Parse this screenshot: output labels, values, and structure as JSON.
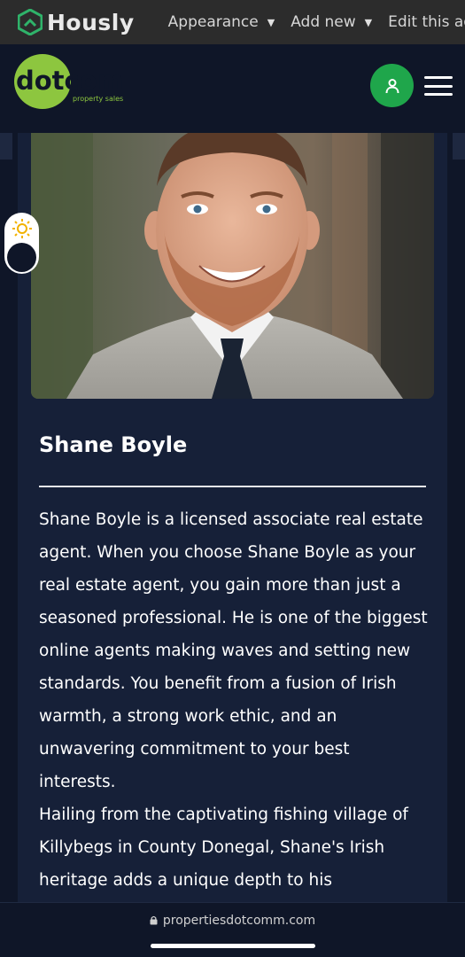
{
  "admin_bar": {
    "logo_text": "Hously",
    "menu": [
      {
        "label": "Appearance",
        "has_dropdown": true
      },
      {
        "label": "Add new",
        "has_dropdown": true
      },
      {
        "label": "Edit this agent",
        "has_dropdown": false
      }
    ]
  },
  "header": {
    "brand_main": "dotcom",
    "brand_sub": "property sales",
    "user_icon": "user-icon",
    "menu_icon": "hamburger-icon"
  },
  "agent": {
    "name": "Shane Boyle",
    "bio": [
      "Shane Boyle is a licensed associate real estate agent. When you choose Shane Boyle as your real estate agent, you gain more than just a seasoned professional. He is one of the biggest online agents making waves and setting new standards. You benefit from a fusion of Irish warmth, a strong work ethic, and an unwavering commitment to your best interests.",
      "Hailing from the captivating fishing village of Killybegs in County Donegal, Shane's Irish heritage adds a unique depth to his"
    ]
  },
  "browser": {
    "url": "propertiesdotcomm.com"
  },
  "colors": {
    "background": "#0f1628",
    "card": "#162038",
    "accent_green": "#1fa64b",
    "brand_green": "#8dc63f",
    "admin_bar": "#2c2c2c"
  }
}
